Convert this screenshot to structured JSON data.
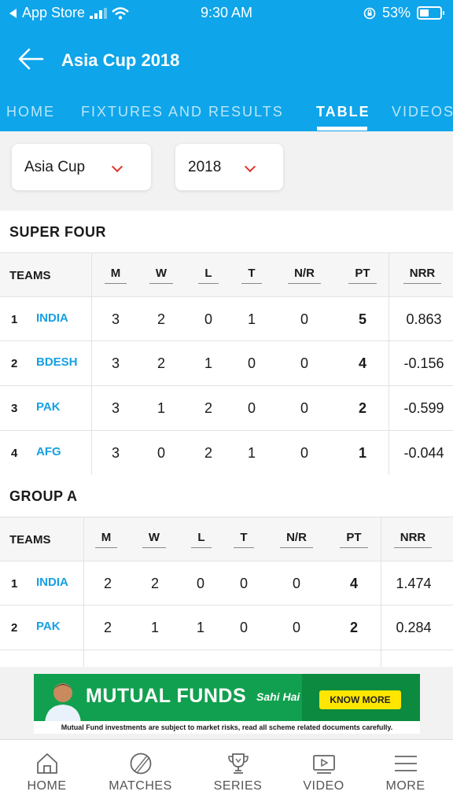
{
  "status_bar": {
    "back_app": "App Store",
    "time": "9:30 AM",
    "battery": "53%",
    "battery_level": 0.53
  },
  "header": {
    "title": "Asia Cup 2018"
  },
  "tabs": [
    {
      "label": "HOME",
      "active": false
    },
    {
      "label": "FIXTURES AND RESULTS",
      "active": false
    },
    {
      "label": "TABLE",
      "active": true
    },
    {
      "label": "VIDEOS",
      "active": false
    }
  ],
  "filters": {
    "tournament": "Asia Cup",
    "year": "2018"
  },
  "columns": [
    "TEAMS",
    "M",
    "W",
    "L",
    "T",
    "N/R",
    "PT",
    "NRR"
  ],
  "super_four": {
    "title": "SUPER FOUR",
    "rows": [
      {
        "rank": "1",
        "team": "INDIA",
        "m": "3",
        "w": "2",
        "l": "0",
        "t": "1",
        "nr": "0",
        "pt": "5",
        "nrr": "0.863"
      },
      {
        "rank": "2",
        "team": "BDESH",
        "m": "3",
        "w": "2",
        "l": "1",
        "t": "0",
        "nr": "0",
        "pt": "4",
        "nrr": "-0.156"
      },
      {
        "rank": "3",
        "team": "PAK",
        "m": "3",
        "w": "1",
        "l": "2",
        "t": "0",
        "nr": "0",
        "pt": "2",
        "nrr": "-0.599"
      },
      {
        "rank": "4",
        "team": "AFG",
        "m": "3",
        "w": "0",
        "l": "2",
        "t": "1",
        "nr": "0",
        "pt": "1",
        "nrr": "-0.044"
      }
    ]
  },
  "group_a": {
    "title": "GROUP A",
    "rows": [
      {
        "rank": "1",
        "team": "INDIA",
        "m": "2",
        "w": "2",
        "l": "0",
        "t": "0",
        "nr": "0",
        "pt": "4",
        "nrr": "1.474"
      },
      {
        "rank": "2",
        "team": "PAK",
        "m": "2",
        "w": "1",
        "l": "1",
        "t": "0",
        "nr": "0",
        "pt": "2",
        "nrr": "0.284"
      }
    ]
  },
  "ad": {
    "title": "MUTUAL FUNDS",
    "tagline": "Sahi Hai",
    "button": "KNOW MORE",
    "disclaimer": "Mutual Fund investments are subject to market risks, read all scheme related documents carefully."
  },
  "bottom_nav": [
    {
      "label": "HOME",
      "icon": "home-icon"
    },
    {
      "label": "MATCHES",
      "icon": "cricket-ball-icon"
    },
    {
      "label": "SERIES",
      "icon": "trophy-icon"
    },
    {
      "label": "VIDEO",
      "icon": "video-play-icon"
    },
    {
      "label": "MORE",
      "icon": "menu-icon"
    }
  ],
  "colors": {
    "brand_blue": "#0ea5ea",
    "team_link": "#16a0e3",
    "chevron_red": "#e3342f",
    "ad_green": "#11a04f",
    "ad_button_yellow": "#ffe600"
  }
}
